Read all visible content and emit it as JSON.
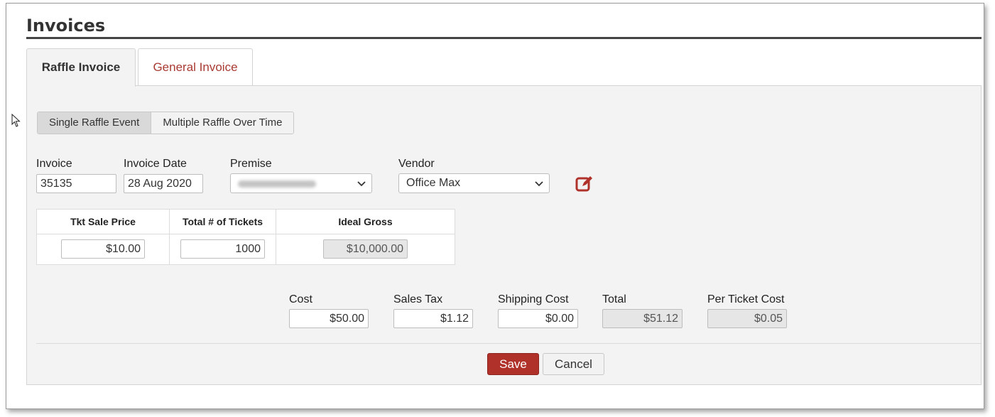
{
  "page_title": "Invoices",
  "tabs": [
    {
      "label": "Raffle Invoice",
      "active": true
    },
    {
      "label": "General Invoice",
      "active": false
    }
  ],
  "mode_toggle": {
    "options": [
      "Single Raffle Event",
      "Multiple Raffle Over Time"
    ],
    "selected": "Single Raffle Event"
  },
  "fields": {
    "invoice": {
      "label": "Invoice",
      "value": "35135"
    },
    "invoice_date": {
      "label": "Invoice Date",
      "value": "28 Aug 2020"
    },
    "premise": {
      "label": "Premise",
      "value": ""
    },
    "vendor": {
      "label": "Vendor",
      "value": "Office Max"
    }
  },
  "ticket_table": {
    "headers": [
      "Tkt Sale Price",
      "Total # of Tickets",
      "Ideal Gross"
    ],
    "values": [
      "$10.00",
      "1000",
      "$10,000.00"
    ]
  },
  "costs": {
    "cost": {
      "label": "Cost",
      "value": "$50.00"
    },
    "sales_tax": {
      "label": "Sales Tax",
      "value": "$1.12"
    },
    "shipping_cost": {
      "label": "Shipping Cost",
      "value": "$0.00"
    },
    "total": {
      "label": "Total",
      "value": "$51.12"
    },
    "per_ticket_cost": {
      "label": "Per Ticket Cost",
      "value": "$0.05"
    }
  },
  "buttons": {
    "save": "Save",
    "cancel": "Cancel"
  },
  "colors": {
    "accent": "#b0302a",
    "tab_link": "#a83a32",
    "panel_bg": "#f3f3f3"
  },
  "icons": {
    "vendor_edit": "edit-square-icon"
  }
}
